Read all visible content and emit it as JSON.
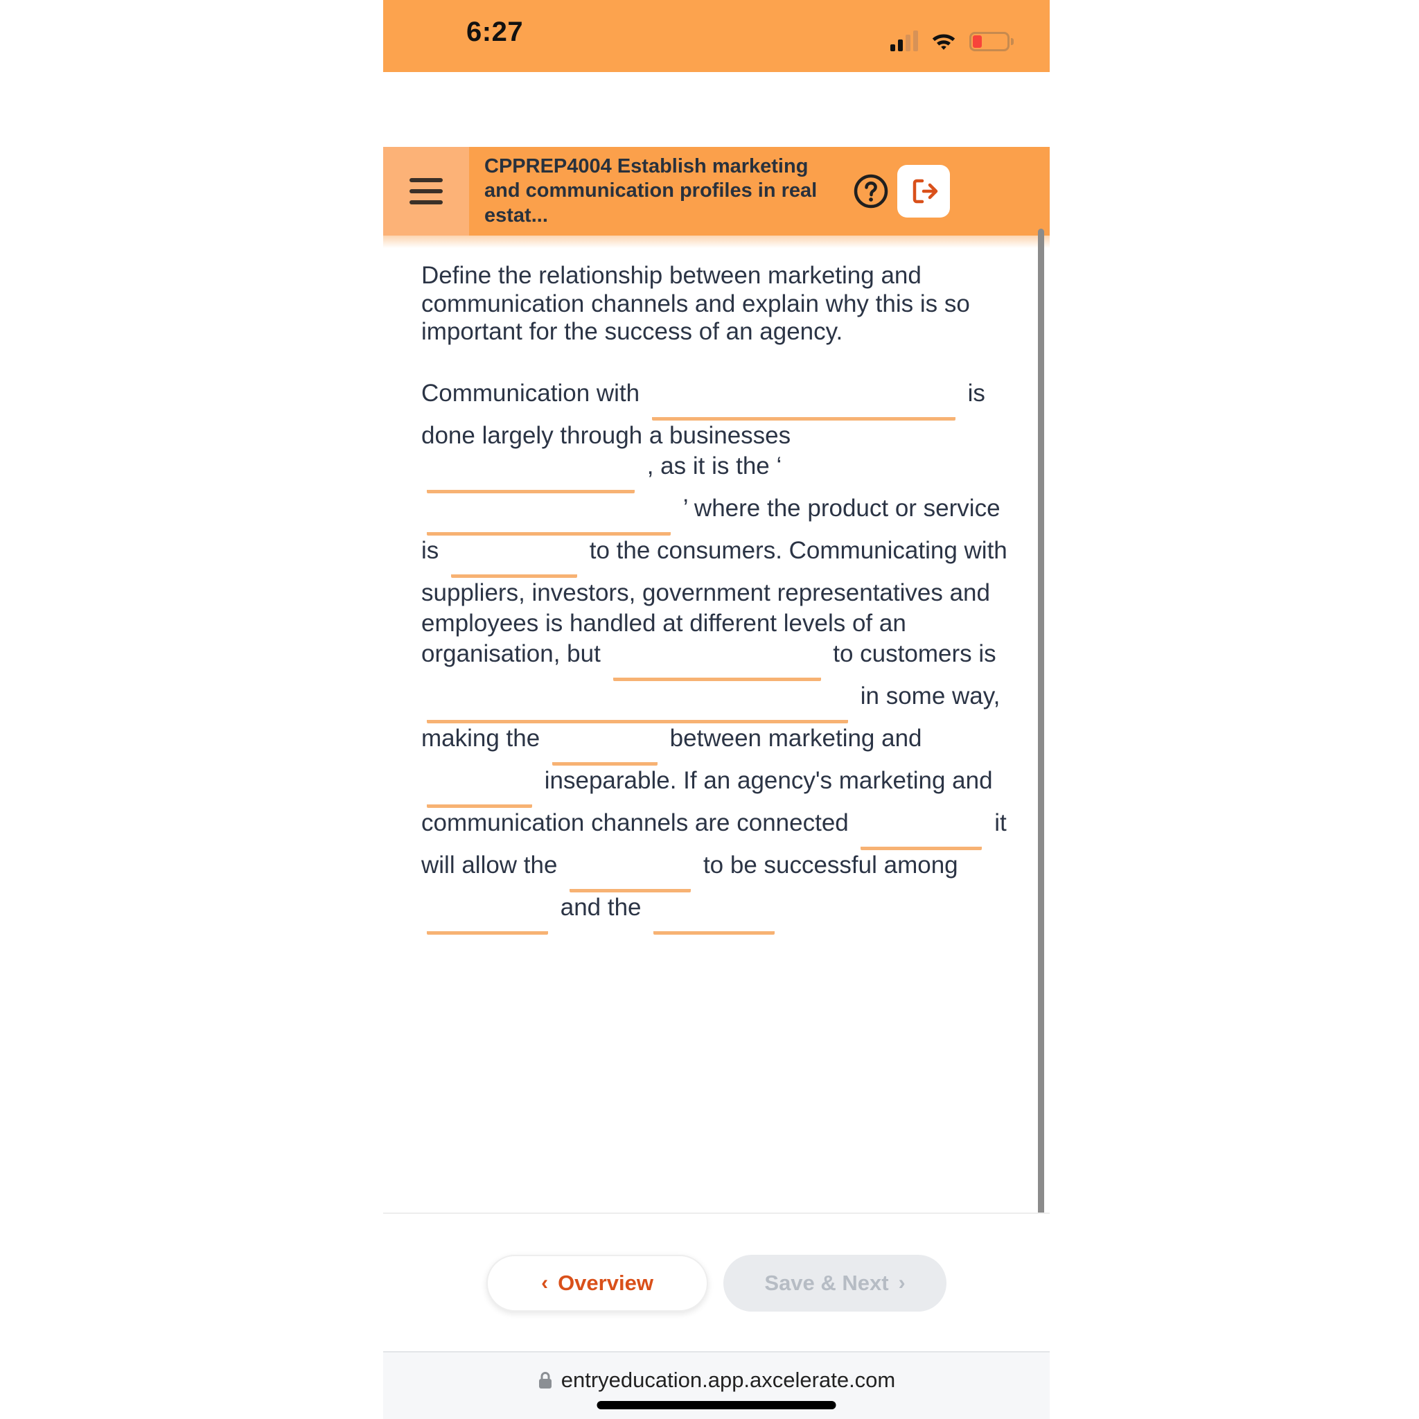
{
  "status_bar": {
    "time": "6:27",
    "signal_icon": "signal-bars-icon",
    "wifi_icon": "wifi-icon",
    "battery_icon": "battery-low-icon"
  },
  "header": {
    "menu_icon": "hamburger-menu-icon",
    "title": "CPPREP4004 Establish marketing and communication profiles in real estat...",
    "help_icon": "help-circle-icon",
    "logout_icon": "logout-icon",
    "bg_color": "#fba04b",
    "menu_bg_color": "#fcb277"
  },
  "question": {
    "prompt": "Define the relationship between marketing and communication channels and explain why this is so important for the success of an agency.",
    "segments": [
      {
        "type": "text",
        "value": "Communication with"
      },
      {
        "type": "blank",
        "value": "",
        "size": "xl"
      },
      {
        "type": "text",
        "value": "is done largely through a businesses"
      },
      {
        "type": "blank",
        "value": "",
        "size": "md"
      },
      {
        "type": "text",
        "value": ", as it is the ‘"
      },
      {
        "type": "blank",
        "value": "",
        "size": "lg"
      },
      {
        "type": "text",
        "value": "’ where the product or service is"
      },
      {
        "type": "blank",
        "value": "",
        "size": "sm"
      },
      {
        "type": "text",
        "value": "to the consumers. Communicating with suppliers, investors, government representatives and employees is handled at different levels of an organisation, but"
      },
      {
        "type": "blank",
        "value": "",
        "size": "md"
      },
      {
        "type": "text",
        "value": "to customers is"
      },
      {
        "type": "blank",
        "value": "",
        "size": "xxl"
      },
      {
        "type": "text",
        "value": "in some way, making the"
      },
      {
        "type": "blank",
        "value": "",
        "size": "xs"
      },
      {
        "type": "text",
        "value": "between marketing and"
      },
      {
        "type": "blank",
        "value": "",
        "size": "xs"
      },
      {
        "type": "text",
        "value": "inseparable. If an agency's marketing and communication channels are connected"
      },
      {
        "type": "blank",
        "value": "",
        "size": "huge"
      },
      {
        "type": "text",
        "value": "it will allow the"
      },
      {
        "type": "blank",
        "value": "",
        "size": "huge"
      },
      {
        "type": "text",
        "value": "to be successful among"
      },
      {
        "type": "blank",
        "value": "",
        "size": "huge"
      },
      {
        "type": "text",
        "value": "and the"
      },
      {
        "type": "blank",
        "value": "",
        "size": "huge"
      }
    ],
    "blank_underline_color": "#f7b273",
    "blank_placeholder": ""
  },
  "bottom_nav": {
    "overview_label": "Overview",
    "overview_chevron": "chevron-left-icon",
    "save_next_label": "Save & Next",
    "save_next_chevron": "chevron-right-icon",
    "overview_color": "#d9501a",
    "save_next_color": "#b6bcc4"
  },
  "browser": {
    "lock_icon": "lock-icon",
    "url": "entryeducation.app.axcelerate.com"
  },
  "scrollbar": {
    "name": "vertical-scrollbar"
  }
}
